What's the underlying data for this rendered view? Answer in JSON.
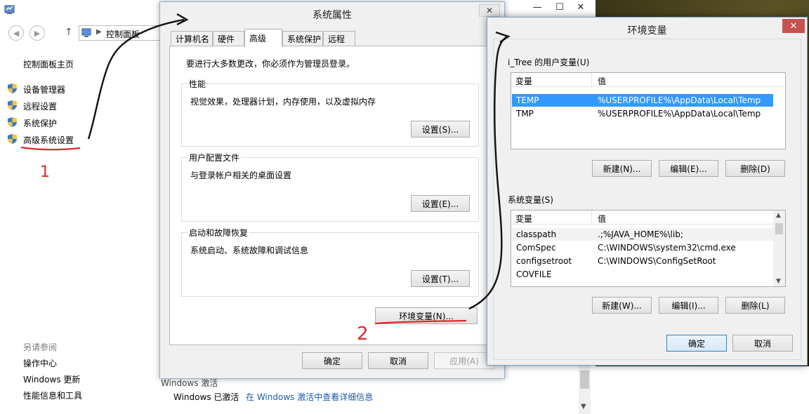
{
  "control_panel": {
    "address_text": "控制面板",
    "address_overflow": "▸",
    "sidebar_home": "控制面板主页",
    "sidebar_items": [
      {
        "label": "设备管理器"
      },
      {
        "label": "远程设置"
      },
      {
        "label": "系统保护"
      },
      {
        "label": "高级系统设置"
      }
    ],
    "see_also_heading": "另请参阅",
    "see_also_items": [
      {
        "label": "操作中心"
      },
      {
        "label": "Windows 更新"
      },
      {
        "label": "性能信息和工具"
      }
    ],
    "activation_status": "Windows 已激活",
    "activation_link": "在 Windows 激活中查看详细信息",
    "partial_heading": "Windows 激活",
    "controls": {
      "minimize": "—",
      "maximize": "☐",
      "close": "✕"
    }
  },
  "system_properties": {
    "title": "系统属性",
    "close": "✕",
    "tabs": [
      {
        "label": "计算机名"
      },
      {
        "label": "硬件"
      },
      {
        "label": "高级",
        "active": true
      },
      {
        "label": "系统保护"
      },
      {
        "label": "远程"
      }
    ],
    "admin_note": "要进行大多数更改，你必须作为管理员登录。",
    "groups": [
      {
        "title": "性能",
        "desc": "视觉效果，处理器计划，内存使用，以及虚拟内存",
        "button": "设置(S)..."
      },
      {
        "title": "用户配置文件",
        "desc": "与登录帐户相关的桌面设置",
        "button": "设置(E)..."
      },
      {
        "title": "启动和故障恢复",
        "desc": "系统启动、系统故障和调试信息",
        "button": "设置(T)..."
      }
    ],
    "env_button": "环境变量(N)...",
    "ok": "确定",
    "cancel": "取消",
    "apply": "应用(A)"
  },
  "environment_variables": {
    "title": "环境变量",
    "close": "✕",
    "user_section_label": "i_Tree 的用户变量(U)",
    "user_columns": [
      "变量",
      "值"
    ],
    "user_rows": [
      {
        "name": "TEMP",
        "value": "%USERPROFILE%\\AppData\\Local\\Temp",
        "selected": true
      },
      {
        "name": "TMP",
        "value": "%USERPROFILE%\\AppData\\Local\\Temp",
        "selected": false
      }
    ],
    "user_buttons": {
      "new": "新建(N)...",
      "edit": "编辑(E)...",
      "delete": "删除(D)"
    },
    "system_section_label": "系统变量(S)",
    "system_columns": [
      "变量",
      "值"
    ],
    "system_rows": [
      {
        "name": "classpath",
        "value": ".;%JAVA_HOME%\\lib;"
      },
      {
        "name": "ComSpec",
        "value": "C:\\WINDOWS\\system32\\cmd.exe"
      },
      {
        "name": "configsetroot",
        "value": "C:\\WINDOWS\\ConfigSetRoot"
      },
      {
        "name": "COVFILE",
        "value": ""
      }
    ],
    "system_buttons": {
      "new": "新建(W)...",
      "edit": "编辑(I)...",
      "delete": "删除(L)"
    },
    "ok": "确定",
    "cancel": "取消"
  },
  "annotations": {
    "step1": "1",
    "step2": "2",
    "color": "#e0262a"
  }
}
